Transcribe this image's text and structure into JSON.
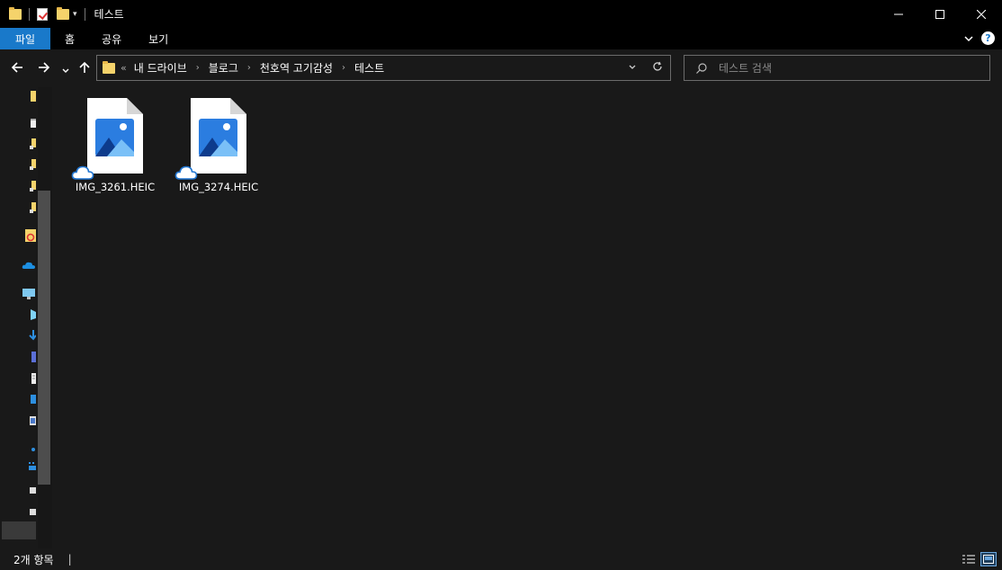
{
  "window": {
    "title": "테스트"
  },
  "ribbon": {
    "tabs": [
      {
        "label": "파일",
        "active": true
      },
      {
        "label": "홈"
      },
      {
        "label": "공유"
      },
      {
        "label": "보기"
      }
    ]
  },
  "address": {
    "overflow": "«",
    "crumbs": [
      "내 드라이브",
      "블로그",
      "천호역 고기감성",
      "테스트"
    ]
  },
  "search": {
    "placeholder": "테스트 검색"
  },
  "files": [
    {
      "name": "IMG_3261.HEIC",
      "icon": "image-file-icon",
      "status": "cloud-icon"
    },
    {
      "name": "IMG_3274.HEIC",
      "icon": "image-file-icon",
      "status": "cloud-icon"
    }
  ],
  "status": {
    "count": "2개 항목"
  },
  "colors": {
    "accent": "#1979ca",
    "background": "#191919",
    "titlebar": "#000000"
  }
}
